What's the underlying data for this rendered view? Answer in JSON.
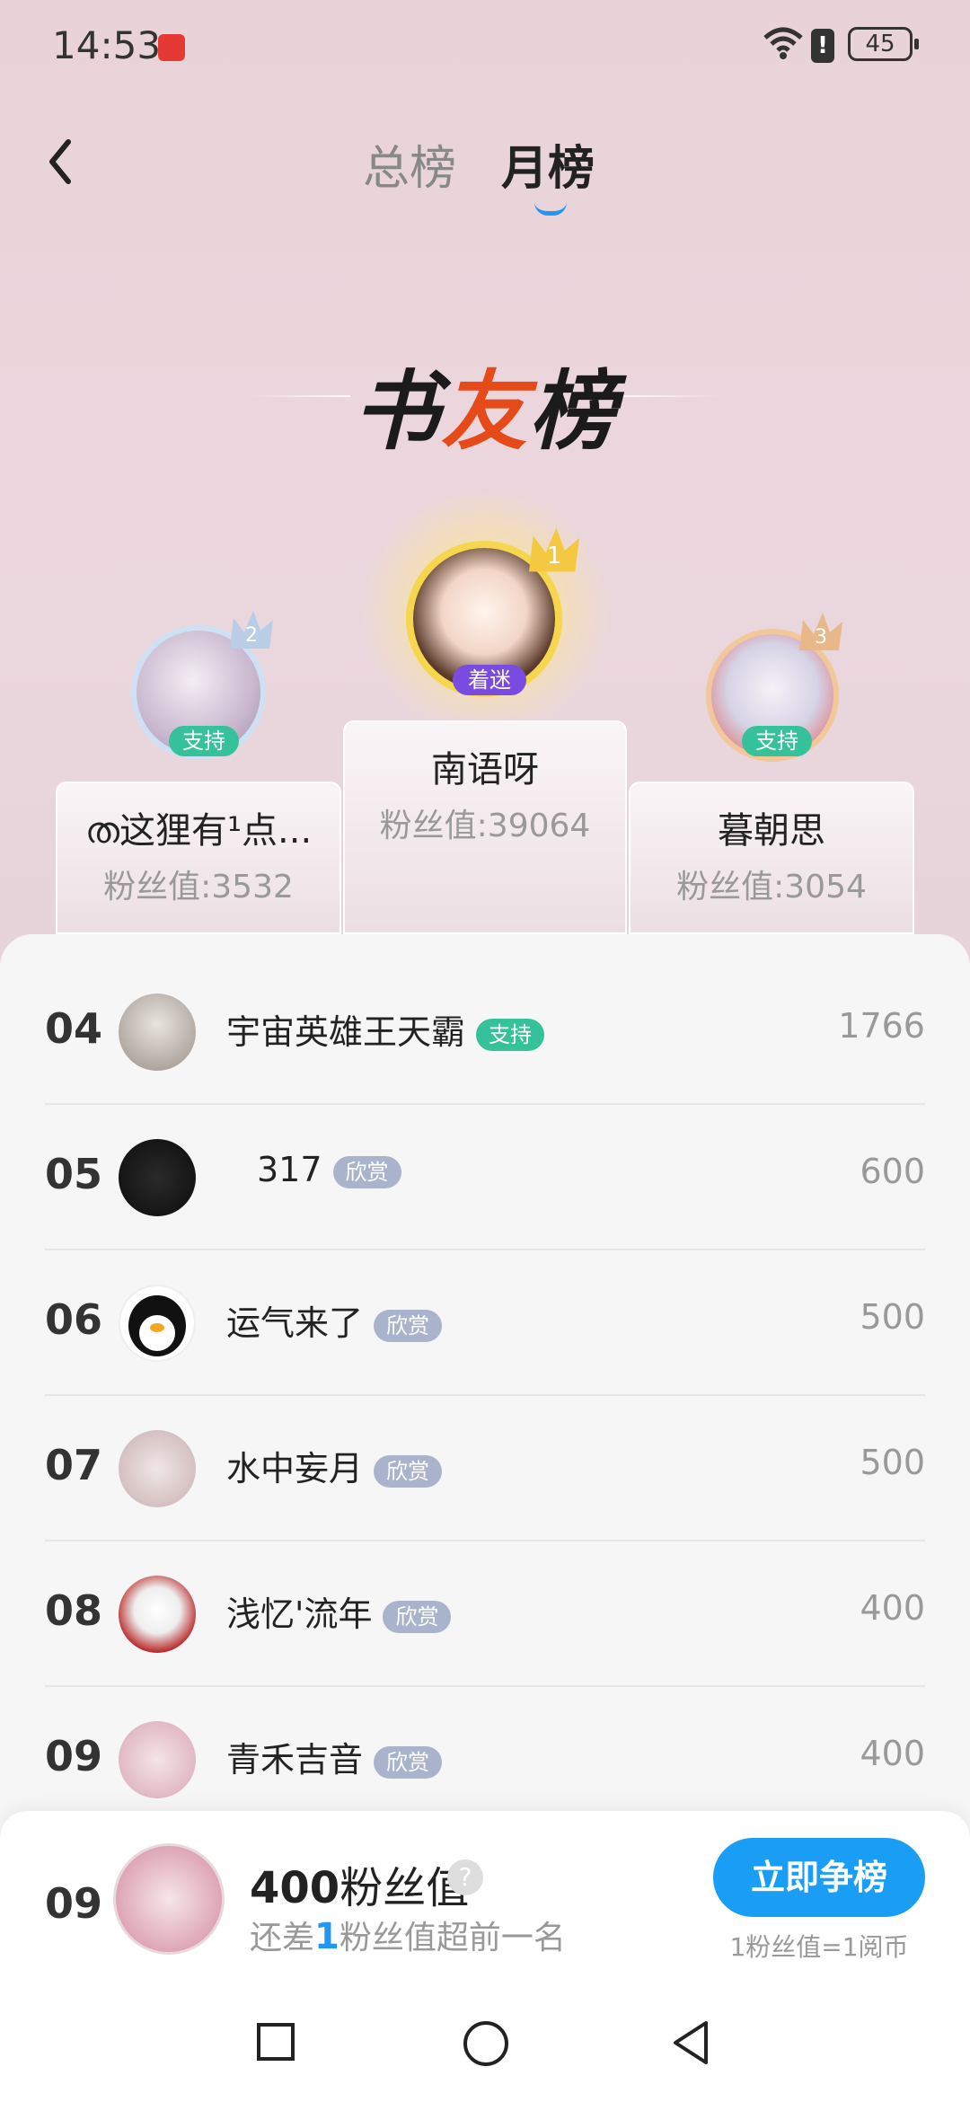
{
  "status_bar": {
    "time": "14:53",
    "battery": "45"
  },
  "header": {
    "tabs": [
      {
        "label": "总榜",
        "active": false
      },
      {
        "label": "月榜",
        "active": true
      }
    ]
  },
  "title": {
    "part1": "书",
    "part2": "友",
    "part3": "榜"
  },
  "podium": {
    "first": {
      "rank": "1",
      "name": "南语呀",
      "fans": "粉丝值:39064",
      "badge": "着迷"
    },
    "second": {
      "rank": "2",
      "name": "ത这狸有¹点...",
      "fans": "粉丝值:3532",
      "badge": "支持"
    },
    "third": {
      "rank": "3",
      "name": "暮朝思",
      "fans": "粉丝值:3054",
      "badge": "支持"
    }
  },
  "list": [
    {
      "rank": "04",
      "name": "宇宙英雄王天霸",
      "tag": "支持",
      "tag_color": "#35c29a",
      "score": "1766"
    },
    {
      "rank": "05",
      "name": "317",
      "tag": "欣赏",
      "tag_color": "#a9b3cc",
      "score": "600"
    },
    {
      "rank": "06",
      "name": "运气来了",
      "tag": "欣赏",
      "tag_color": "#a9b3cc",
      "score": "500"
    },
    {
      "rank": "07",
      "name": "水中妄月",
      "tag": "欣赏",
      "tag_color": "#a9b3cc",
      "score": "500"
    },
    {
      "rank": "08",
      "name": "浅忆'流年",
      "tag": "欣赏",
      "tag_color": "#a9b3cc",
      "score": "400"
    },
    {
      "rank": "09",
      "name": "青禾吉音",
      "tag": "欣赏",
      "tag_color": "#a9b3cc",
      "score": "400"
    }
  ],
  "my_rank": {
    "rank": "09",
    "score_value": "400",
    "score_label": "粉丝值",
    "help": "?",
    "sub_prefix": "还差",
    "sub_number": "1",
    "sub_suffix": "粉丝值超前一名",
    "button": "立即争榜",
    "rate": "1粉丝值=1阅币"
  },
  "colors": {
    "accent": "#1a9df5",
    "support": "#35c29a",
    "appreciate": "#a9b3cc",
    "obsessed": "#7a4be0"
  }
}
